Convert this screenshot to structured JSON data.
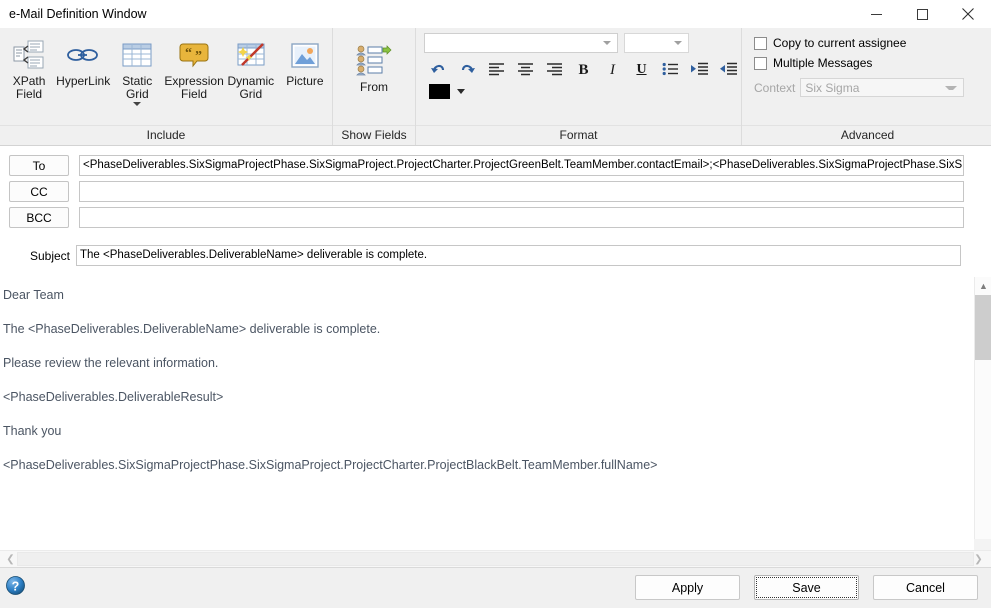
{
  "window": {
    "title": "e-Mail Definition Window",
    "controls": {
      "minimize": "minimize-icon",
      "maximize": "maximize-icon",
      "close": "close-icon"
    }
  },
  "ribbon": {
    "groups": [
      {
        "label": "Include",
        "buttons": [
          {
            "caption_line1": "XPath",
            "caption_line2": "Field",
            "icon": "xpath-field-icon",
            "has_dropdown": false
          },
          {
            "caption_line1": "HyperLink",
            "caption_line2": "",
            "icon": "hyperlink-icon",
            "has_dropdown": false
          },
          {
            "caption_line1": "Static",
            "caption_line2": "Grid",
            "icon": "static-grid-icon",
            "has_dropdown": true
          },
          {
            "caption_line1": "Expression",
            "caption_line2": "Field",
            "icon": "expression-field-icon",
            "has_dropdown": false
          },
          {
            "caption_line1": "Dynamic",
            "caption_line2": "Grid",
            "icon": "dynamic-grid-icon",
            "has_dropdown": false
          },
          {
            "caption_line1": "Picture",
            "caption_line2": "",
            "icon": "picture-icon",
            "has_dropdown": false
          }
        ]
      },
      {
        "label": "Show Fields",
        "buttons": [
          {
            "caption_line1": "From",
            "caption_line2": "",
            "icon": "from-field-icon",
            "has_dropdown": false
          }
        ]
      },
      {
        "label": "Format",
        "font_combo_value": "",
        "size_combo_value": "",
        "font_color": "#000000",
        "tools": [
          "undo-icon",
          "redo-icon",
          "align-left-icon",
          "align-center-icon",
          "align-right-icon",
          "bold-icon",
          "italic-icon",
          "underline-icon",
          "bullet-list-icon",
          "increase-indent-icon",
          "decrease-indent-icon"
        ]
      },
      {
        "label": "Advanced",
        "copy_assignee_label": "Copy to current assignee",
        "copy_assignee_checked": false,
        "multiple_messages_label": "Multiple Messages",
        "multiple_messages_checked": false,
        "context_label": "Context",
        "context_value": "Six Sigma",
        "context_disabled": true
      }
    ]
  },
  "form": {
    "to_label": "To",
    "to_value": "<PhaseDeliverables.SixSigmaProjectPhase.SixSigmaProject.ProjectCharter.ProjectGreenBelt.TeamMember.contactEmail>;<PhaseDeliverables.SixSigmaProjectPhase.SixSigmaProject.Proj",
    "cc_label": "CC",
    "cc_value": "",
    "bcc_label": "BCC",
    "bcc_value": "",
    "subject_label": "Subject",
    "subject_value": "The <PhaseDeliverables.DeliverableName> deliverable  is complete."
  },
  "body": {
    "paragraphs": [
      "Dear Team",
      "The <PhaseDeliverables.DeliverableName> deliverable  is complete.",
      "Please review the relevant information.",
      "<PhaseDeliverables.DeliverableResult>",
      "Thank you",
      "<PhaseDeliverables.SixSigmaProjectPhase.SixSigmaProject.ProjectCharter.ProjectBlackBelt.TeamMember.fullName>"
    ]
  },
  "footer": {
    "help_icon": "help-icon",
    "buttons": [
      {
        "label": "Apply",
        "focused": false
      },
      {
        "label": "Save",
        "focused": true
      },
      {
        "label": "Cancel",
        "focused": false
      }
    ]
  }
}
